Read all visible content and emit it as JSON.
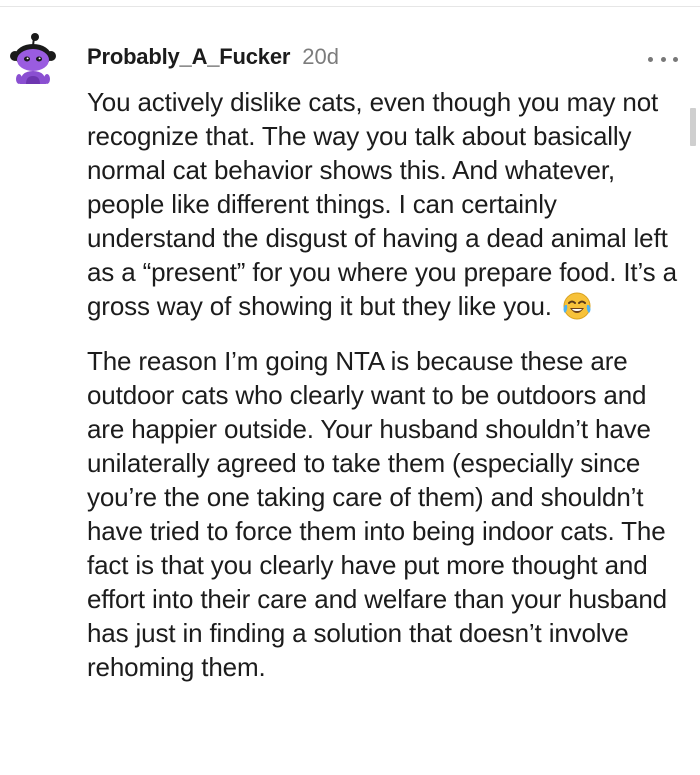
{
  "comment": {
    "username": "Probably_A_Fucker",
    "age": "20d",
    "avatar_icon": "snoo-avatar-icon",
    "more_icon": "more-options-icon",
    "emoji_icon": "tears-of-joy-emoji",
    "paragraph_1": "You actively dislike cats, even though you may not recognize that. The way you talk about basically normal cat behavior shows this. And whatever, people like different things. I can certainly understand the disgust of having a dead animal left as a “present” for you where you prepare food. It’s a gross way of showing it but they like you.",
    "paragraph_2": "The reason I’m going NTA is because these are outdoor cats who clearly want to be outdoors and are happier outside. Your husband shouldn’t have unilaterally agreed to take them (especially since you’re the one taking care of them) and shouldn’t have tried to force them into being indoor cats. The fact is that you clearly have put more thought and effort into their care and welfare than your husband has just in finding a solution that doesn’t involve rehoming them."
  },
  "colors": {
    "text": "#1c1c1c",
    "meta_gray": "#7c7c7c",
    "avatar_purple": "#8a4fd1"
  }
}
